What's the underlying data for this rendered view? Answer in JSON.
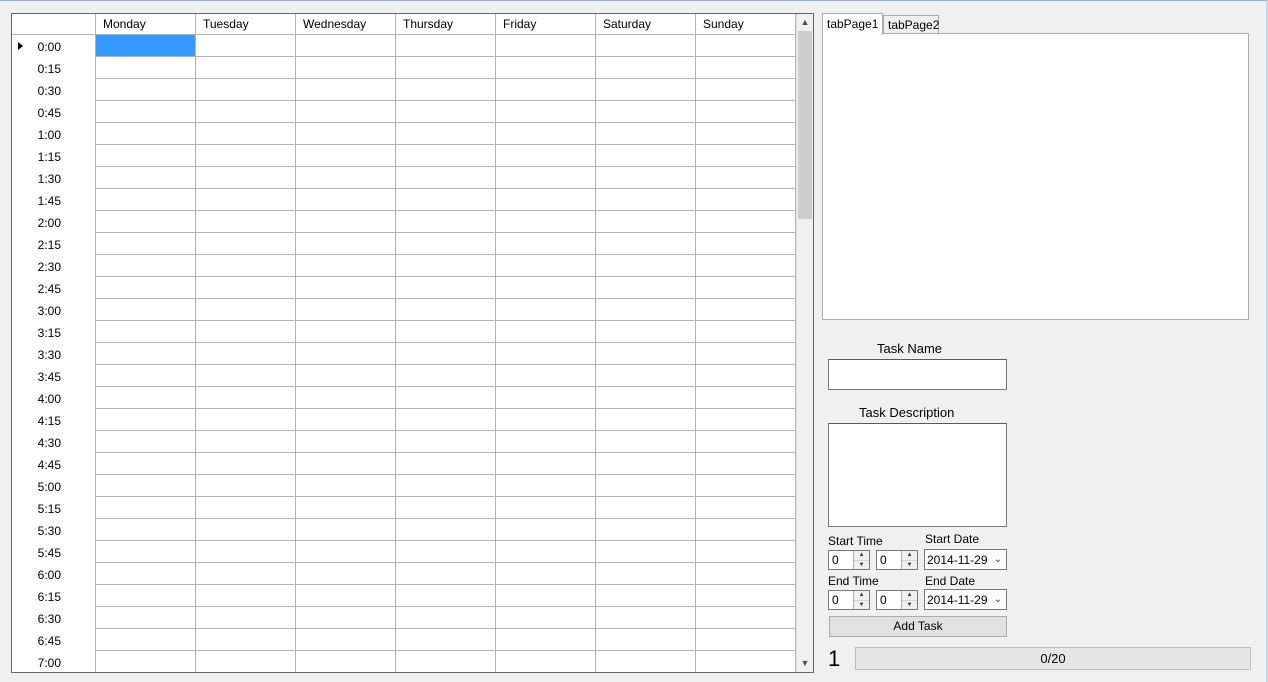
{
  "schedule": {
    "days": [
      "Monday",
      "Tuesday",
      "Wednesday",
      "Thursday",
      "Friday",
      "Saturday",
      "Sunday"
    ],
    "times": [
      "0:00",
      "0:15",
      "0:30",
      "0:45",
      "1:00",
      "1:15",
      "1:30",
      "1:45",
      "2:00",
      "2:15",
      "2:30",
      "2:45",
      "3:00",
      "3:15",
      "3:30",
      "3:45",
      "4:00",
      "4:15",
      "4:30",
      "4:45",
      "5:00",
      "5:15",
      "5:30",
      "5:45",
      "6:00",
      "6:15",
      "6:30",
      "6:45",
      "7:00"
    ],
    "current_row": "0:00",
    "selected_cell": {
      "time": "0:00",
      "day": "Monday"
    },
    "selection_color": "#3399ff"
  },
  "tabs": [
    {
      "label": "tabPage1",
      "active": true
    },
    {
      "label": "tabPage2",
      "active": false
    }
  ],
  "form": {
    "task_name_label": "Task Name",
    "task_name_value": "",
    "task_description_label": "Task Description",
    "task_description_value": "",
    "start_time_label": "Start Time",
    "start_hour": "0",
    "start_minute": "0",
    "start_date_label": "Start Date",
    "start_date": "2014-11-29",
    "end_time_label": "End Time",
    "end_hour": "0",
    "end_minute": "0",
    "end_date_label": "End Date",
    "end_date": "2014-11-29",
    "add_task_label": "Add Task"
  },
  "status": {
    "counter": "1",
    "progress_text": "0/20",
    "progress_fraction": 0
  }
}
